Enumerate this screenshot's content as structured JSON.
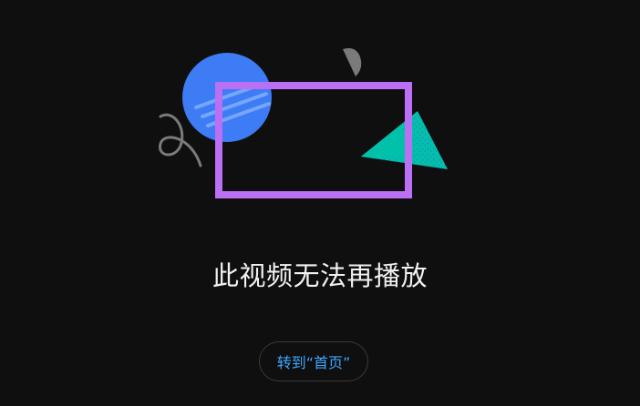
{
  "error": {
    "message": "此视频无法再播放",
    "home_button_label": "转到“首页”"
  },
  "colors": {
    "background": "#0f0f0f",
    "message_text": "#f1f1f1",
    "button_text": "#3ea6ff",
    "button_border": "#3a3a3a",
    "circle": "#3d7cf5",
    "rectangle": "#bb6ff5",
    "triangle": "#00c2a8",
    "half_circle": "#7a7a7a",
    "squiggle": "#7a7a7a"
  },
  "illustration": {
    "icons": [
      "blue-circle-shape",
      "purple-rectangle-shape",
      "teal-triangle-shape",
      "gray-half-circle-shape",
      "gray-squiggle-shape"
    ]
  }
}
